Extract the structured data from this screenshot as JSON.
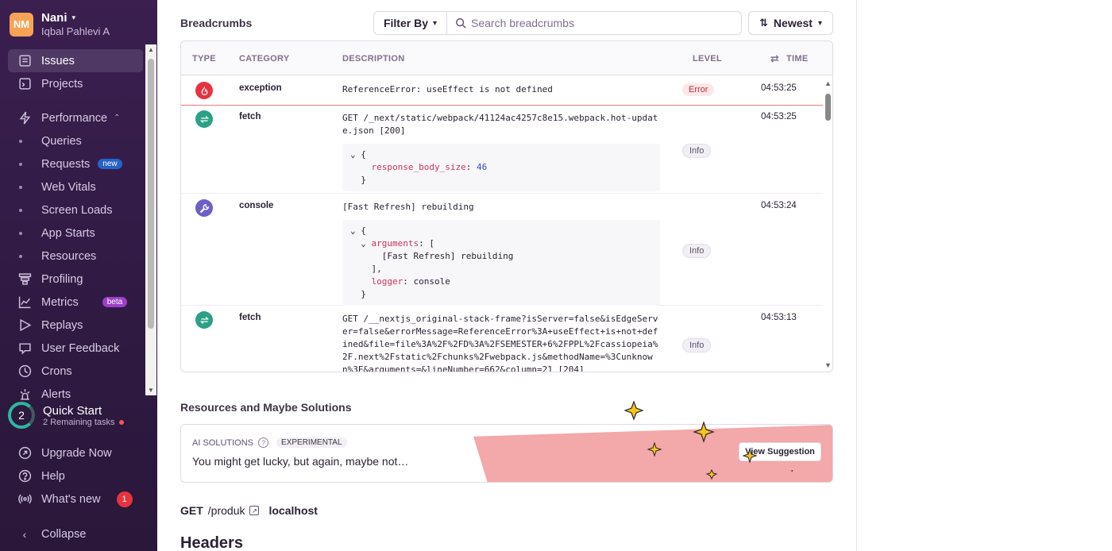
{
  "org": {
    "initials": "NM",
    "name": "Nani",
    "user": "Iqbal Pahlevi A"
  },
  "sidebar": {
    "items": [
      {
        "label": "Issues",
        "icon": "issues-icon",
        "active": true
      },
      {
        "label": "Projects",
        "icon": "projects-icon"
      },
      {
        "label": "Performance",
        "icon": "performance-icon",
        "expanded": true
      },
      {
        "label": "Queries",
        "sub": true
      },
      {
        "label": "Requests",
        "sub": true,
        "badge": "new"
      },
      {
        "label": "Web Vitals",
        "sub": true
      },
      {
        "label": "Screen Loads",
        "sub": true
      },
      {
        "label": "App Starts",
        "sub": true
      },
      {
        "label": "Resources",
        "sub": true
      },
      {
        "label": "Profiling",
        "icon": "profiling-icon"
      },
      {
        "label": "Metrics",
        "icon": "metrics-icon",
        "badge": "beta"
      },
      {
        "label": "Replays",
        "icon": "replays-icon"
      },
      {
        "label": "User Feedback",
        "icon": "feedback-icon"
      },
      {
        "label": "Crons",
        "icon": "crons-icon"
      },
      {
        "label": "Alerts",
        "icon": "alerts-icon"
      }
    ],
    "quick_start": {
      "count": "2",
      "title": "Quick Start",
      "subtitle": "2 Remaining tasks"
    },
    "bottom": [
      {
        "label": "Upgrade Now",
        "icon": "rocket-icon"
      },
      {
        "label": "Help",
        "icon": "help-icon"
      },
      {
        "label": "What's new",
        "icon": "broadcast-icon",
        "count": "1"
      }
    ],
    "collapse": "Collapse"
  },
  "breadcrumbs": {
    "title": "Breadcrumbs",
    "filter_label": "Filter By",
    "search_placeholder": "Search breadcrumbs",
    "sort_label": "Newest",
    "columns": {
      "type": "TYPE",
      "category": "CATEGORY",
      "description": "DESCRIPTION",
      "level": "LEVEL",
      "time": "TIME"
    },
    "rows": [
      {
        "category": "exception",
        "desc_prefix": "ReferenceError:",
        "desc": "useEffect is not defined",
        "level": "Error",
        "time": "04:53:25"
      },
      {
        "category": "fetch",
        "desc": "GET /_next/static/webpack/41124ac4257c8e15.webpack.hot-update.json [200]",
        "code_key": "response_body_size",
        "code_val": "46",
        "level": "Info",
        "time": "04:53:25"
      },
      {
        "category": "console",
        "desc": "[Fast Refresh] rebuilding",
        "code_key1": "arguments",
        "code_arg": "[Fast Refresh] rebuilding",
        "code_key2": "logger",
        "code_val2": "console",
        "level": "Info",
        "time": "04:53:24"
      },
      {
        "category": "fetch",
        "desc": "GET /__nextjs_original-stack-frame?isServer=false&isEdgeServer=false&errorMessage=ReferenceError%3A+useEffect+is+not+defined&file=file%3A%2F%2FD%3A%2FSEMESTER+6%2FPPL%2Fcassiopeia%2F.next%2Fstatic%2Fchunks%2Fwebpack.js&methodName=%3Cunknown%3E&arguments=&lineNumber=662&column=21 [204]",
        "level": "Info",
        "time": "04:53:13"
      }
    ]
  },
  "solutions": {
    "title": "Resources and Maybe Solutions",
    "label": "AI SOLUTIONS",
    "tag": "EXPERIMENTAL",
    "text": "You might get lucky, but again, maybe not…",
    "button": "View Suggestion"
  },
  "request": {
    "method": "GET",
    "path": "/produk",
    "host": "localhost"
  },
  "headers_title": "Headers",
  "colors": {
    "sidebar": "#3a1f4f",
    "error": "#e5343f",
    "fetch": "#2ba185",
    "console": "#6c5fc7",
    "banner": "#f3a8a9"
  }
}
